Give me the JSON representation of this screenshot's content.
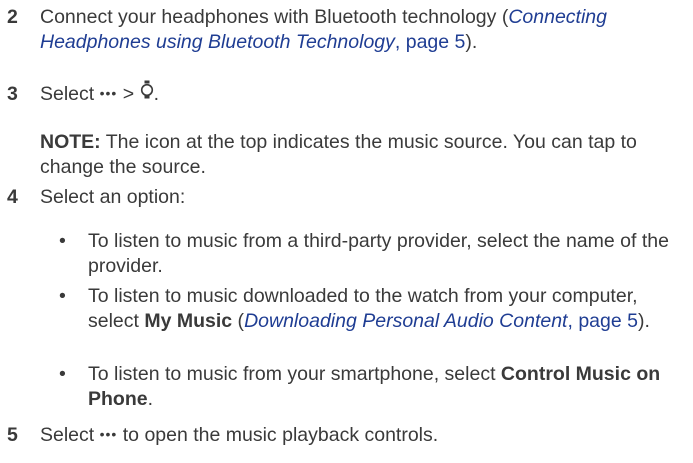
{
  "steps": [
    {
      "number": "2",
      "text_before": "Connect your headphones with Bluetooth technology (",
      "link_title": "Connecting Headphones using Bluetooth Technology",
      "link_page": ", page 5",
      "text_after": ")."
    },
    {
      "number": "3",
      "text_select": "Select ",
      "separator": " > ",
      "icon_more": "more-options-icon",
      "icon_music": "music-source-icon",
      "text_end": ".",
      "note_label": "NOTE:",
      "note_text": " The icon at the top indicates the music source. You can tap to change the source."
    },
    {
      "number": "4",
      "text": "Select an option:",
      "bullets": [
        {
          "text": "To listen to music from a third-party provider, select the name of the provider."
        },
        {
          "text_before": "To listen to music downloaded to the watch from your computer, select ",
          "bold": "My Music",
          "paren_open": " (",
          "link_title": "Downloading Personal Audio Content",
          "link_page": ", page 5",
          "text_after": ")."
        },
        {
          "text_before": "To listen to music from your smartphone, select ",
          "bold": "Control Music on Phone",
          "text_after": "."
        }
      ]
    },
    {
      "number": "5",
      "text_select": "Select ",
      "icon_more": "more-options-icon",
      "text_after": " to open the music playback controls."
    }
  ],
  "bullet_char": "•"
}
